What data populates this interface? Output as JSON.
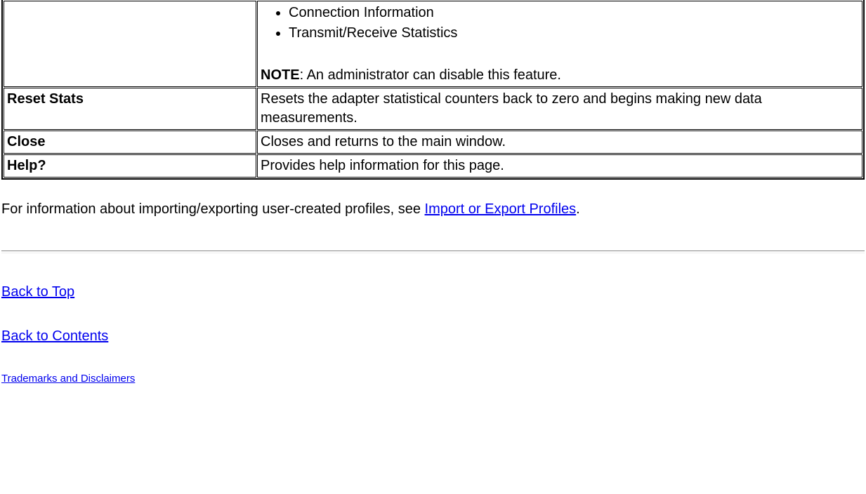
{
  "table": {
    "row0": {
      "label": "",
      "list": {
        "item0": "Connection Information",
        "item1": "Transmit/Receive Statistics"
      },
      "note_label": "NOTE",
      "note_text": ": An administrator can disable this feature."
    },
    "row1": {
      "label": "Reset Stats",
      "desc": "Resets the adapter statistical counters back to zero and begins making new data measurements."
    },
    "row2": {
      "label": "Close",
      "desc": "Closes and returns to the main window."
    },
    "row3": {
      "label": "Help?",
      "desc": "Provides help information for this page."
    }
  },
  "info": {
    "prefix": "For information about importing/exporting user-created profiles, see ",
    "link": "Import or Export Profiles",
    "suffix": "."
  },
  "nav": {
    "back_to_top": "Back to Top",
    "back_to_contents": "Back to Contents",
    "trademarks": "Trademarks and Disclaimers"
  }
}
